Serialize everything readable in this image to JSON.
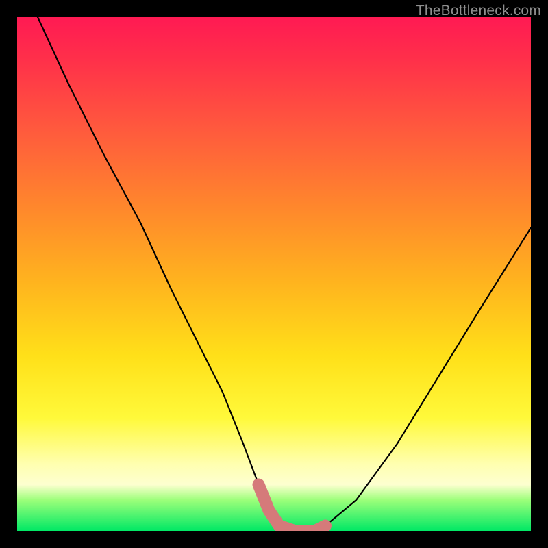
{
  "watermark": "TheBottleneck.com",
  "chart_data": {
    "type": "line",
    "title": "",
    "xlabel": "",
    "ylabel": "",
    "xlim": [
      0,
      100
    ],
    "ylim": [
      0,
      100
    ],
    "grid": false,
    "series": [
      {
        "name": "bottleneck-curve",
        "x": [
          4,
          10,
          17,
          24,
          30,
          35,
          40,
          44,
          47,
          49,
          51,
          54,
          56,
          58,
          60,
          66,
          74,
          82,
          90,
          100
        ],
        "y": [
          100,
          87,
          73,
          60,
          47,
          37,
          27,
          17,
          9,
          4,
          1,
          0,
          0,
          0,
          1,
          6,
          17,
          30,
          43,
          59
        ]
      }
    ],
    "bottom_marker": {
      "name": "flat-zone-marker",
      "x": [
        47,
        49,
        51,
        54,
        56,
        58,
        60
      ],
      "y": [
        9,
        4,
        1,
        0,
        0,
        0,
        1
      ],
      "color": "#d57a7a"
    },
    "background_gradient": {
      "top": "#ff1a53",
      "mid": "#ffe019",
      "bottom": "#00e865"
    }
  }
}
